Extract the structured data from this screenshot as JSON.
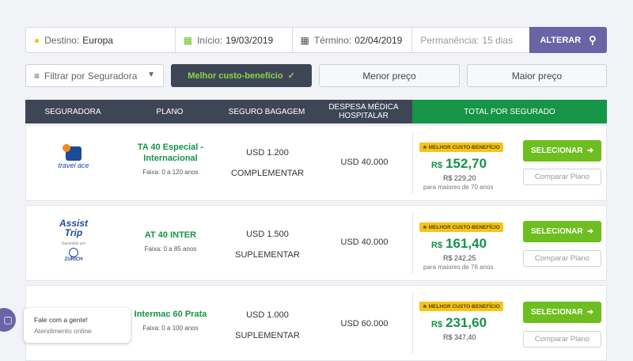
{
  "search": {
    "destino_label": "Destino:",
    "destino_value": "Europa",
    "inicio_label": "Início:",
    "inicio_value": "19/03/2019",
    "termino_label": "Término:",
    "termino_value": "02/04/2019",
    "permanencia_label": "Permanência:",
    "permanencia_value": "15 dias",
    "alterar_label": "ALTERAR"
  },
  "filters": {
    "seguradora_placeholder": "Filtrar por Seguradora",
    "melhor": "Melhor custo-benefício",
    "menor": "Menor preço",
    "maior": "Maior preço"
  },
  "table": {
    "headers": [
      "SEGURADORA",
      "PLANO",
      "SEGURO BAGAGEM",
      "DESPESA MÉDICA HOSPITALAR",
      "TOTAL POR SEGURADO"
    ]
  },
  "offers": [
    {
      "insurer": "travel ace",
      "plan": "TA 40 Especial - Internacional",
      "faixa": "Faixa: 0 a 120 anos",
      "bag1": "USD 1.200",
      "bag2": "COMPLEMENTAR",
      "medical": "USD 40.000",
      "badge": "MELHOR CUSTO-BENEFÍCIO",
      "currency": "R$",
      "price": "152,70",
      "older_price": "R$ 229,20",
      "older_note": "para maiores de 70 anos",
      "select": "SELECIONAR",
      "compare": "Comparar Plano"
    },
    {
      "insurer": "Assist Trip",
      "insurer_sub": "Garantido por",
      "insurer_partner": "ZURICH",
      "plan": "AT 40 INTER",
      "faixa": "Faixa: 0 a 85 anos",
      "bag1": "USD 1.500",
      "bag2": "SUPLEMENTAR",
      "medical": "USD 40.000",
      "badge": "MELHOR CUSTO-BENEFÍCIO",
      "currency": "R$",
      "price": "161,40",
      "older_price": "R$ 242,25",
      "older_note": "para maiores de 76 anos",
      "select": "SELECIONAR",
      "compare": "Comparar Plano"
    },
    {
      "insurer": "",
      "plan": "Intermac 60 Prata",
      "faixa": "Faixa: 0 a 100 anos",
      "bag1": "USD 1.000",
      "bag2": "SUPLEMENTAR",
      "medical": "USD 60.000",
      "badge": "MELHOR CUSTO-BENEFÍCIO",
      "currency": "R$",
      "price": "231,60",
      "older_price": "R$ 347,40",
      "select": "SELECIONAR",
      "compare": "Comparar Plano"
    }
  ],
  "chat": {
    "title": "Fale com a gente!",
    "status": "Atendimento online"
  },
  "colors": {
    "header_dark": "#3e4656",
    "green": "#169447",
    "button_green": "#6cbf1f",
    "accent_purple": "#6b63a6",
    "badge_yellow": "#f5c518"
  }
}
